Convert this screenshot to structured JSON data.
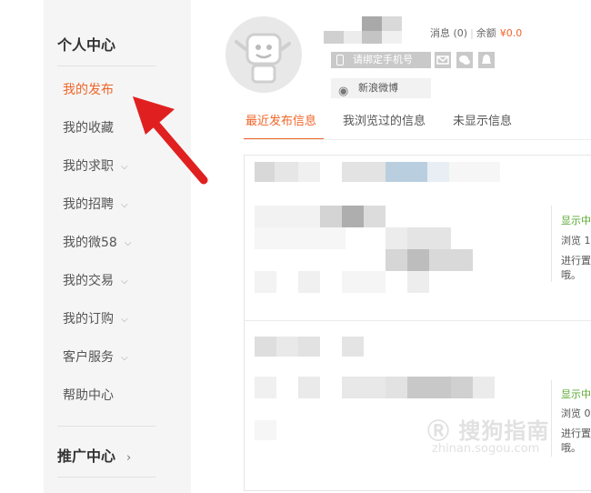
{
  "sidebar": {
    "title": "个人中心",
    "items": [
      {
        "label": "我的发布",
        "has_chevron": false,
        "active": true
      },
      {
        "label": "我的收藏",
        "has_chevron": false
      },
      {
        "label": "我的求职",
        "has_chevron": true
      },
      {
        "label": "我的招聘",
        "has_chevron": true
      },
      {
        "label": "我的微58",
        "has_chevron": true
      },
      {
        "label": "我的交易",
        "has_chevron": true
      },
      {
        "label": "我的订购",
        "has_chevron": true
      },
      {
        "label": "客户服务",
        "has_chevron": true
      },
      {
        "label": "帮助中心",
        "has_chevron": false
      }
    ],
    "promo_title": "推广中心",
    "promo_chevron": "›",
    "chevron": "⌵"
  },
  "profile": {
    "messages_label": "消息 (0)",
    "balance_label": "余额",
    "balance_value": "¥0.0",
    "bind_phone": "请绑定手机号",
    "weibo": "新浪微博",
    "weibo_icon": "weibo-icon"
  },
  "tabs": [
    {
      "label": "最近发布信息",
      "active": true
    },
    {
      "label": "我浏览过的信息"
    },
    {
      "label": "未显示信息"
    }
  ],
  "posts": [
    {
      "status": "显示中",
      "views": "浏览 1",
      "note_line1": "进行置",
      "note_line2": "哦。"
    },
    {
      "status": "显示中",
      "views": "浏览 0",
      "note_line1": "进行置",
      "note_line2": "哦。"
    }
  ],
  "watermark": {
    "text": "搜狗指南",
    "url": "zhinan.sogou.com"
  },
  "colors": {
    "accent": "#f0662a",
    "green": "#5aa832",
    "sidebar_bg": "#f5f5f5"
  }
}
